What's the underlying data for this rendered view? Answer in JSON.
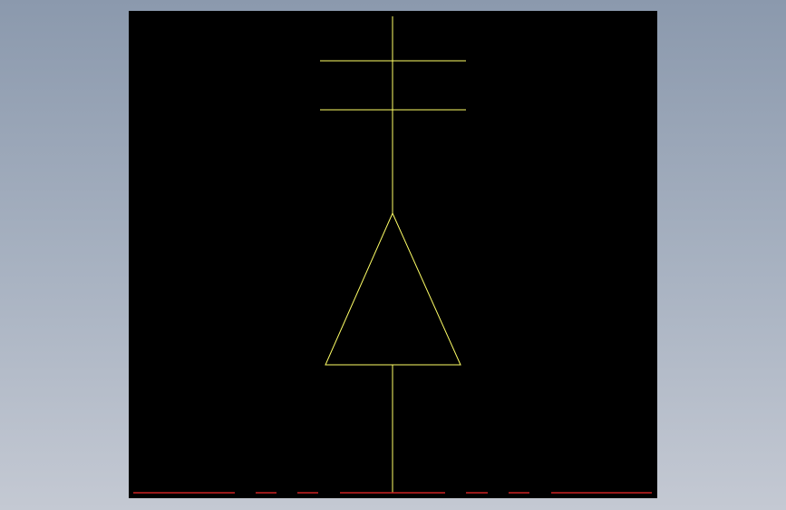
{
  "drawing": {
    "background_color": "#000000",
    "stroke_color": "#ffff66",
    "border_color": "#cc2222",
    "symbol": "electrical-symbol-with-triangle"
  }
}
